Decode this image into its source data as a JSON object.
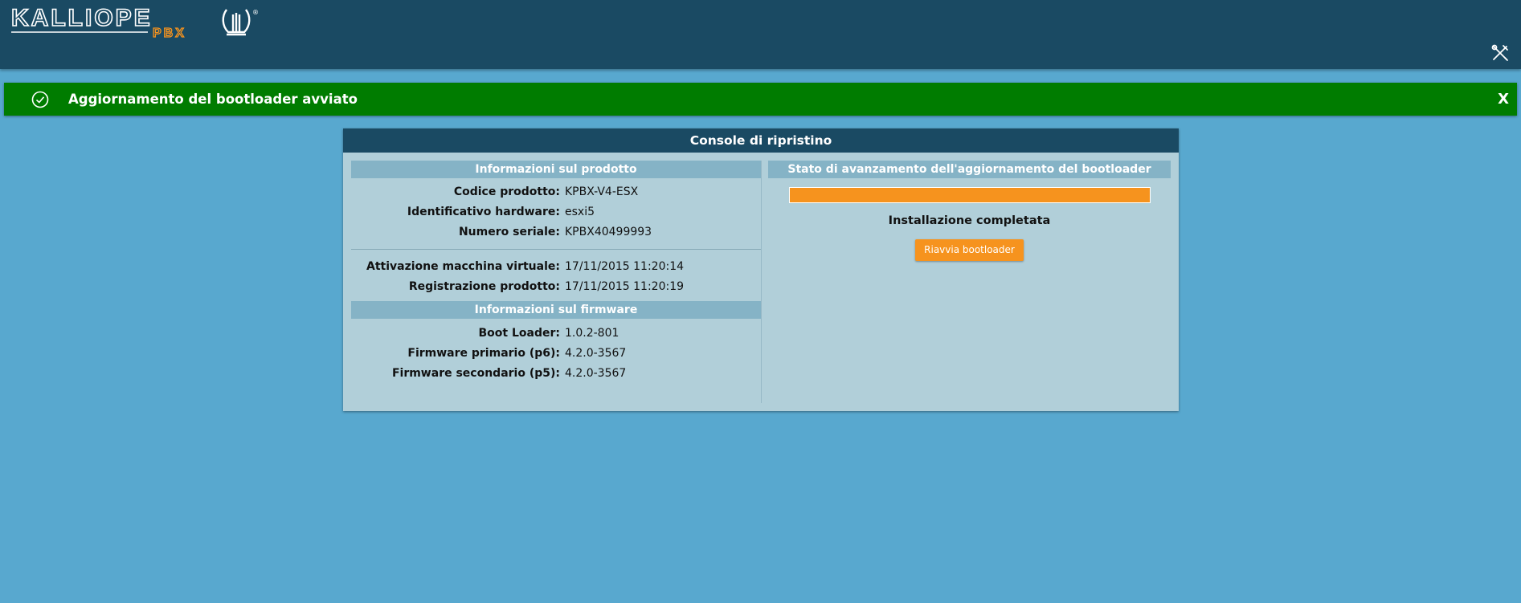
{
  "header": {
    "logo_text": "KALLIOPE",
    "logo_subtext": "PBX",
    "tools_icon": "tools-icon"
  },
  "alert": {
    "icon": "check-circle-icon",
    "message": "Aggiornamento del bootloader avviato",
    "close_label": "X",
    "color": "#007c00"
  },
  "panel": {
    "title": "Console di ripristino",
    "product_section": {
      "title": "Informazioni sul prodotto",
      "rows": [
        {
          "label": "Codice prodotto:",
          "value": "KPBX-V4-ESX"
        },
        {
          "label": "Identificativo hardware:",
          "value": "esxi5"
        },
        {
          "label": "Numero seriale:",
          "value": "KPBX40499993"
        }
      ],
      "rows2": [
        {
          "label": "Attivazione macchina virtuale:",
          "value": "17/11/2015 11:20:14"
        },
        {
          "label": "Registrazione prodotto:",
          "value": "17/11/2015 11:20:19"
        }
      ]
    },
    "firmware_section": {
      "title": "Informazioni sul firmware",
      "rows": [
        {
          "label": "Boot Loader:",
          "value": "1.0.2-801"
        },
        {
          "label": "Firmware primario (p6):",
          "value": "4.2.0-3567"
        },
        {
          "label": "Firmware secondario (p5):",
          "value": "4.2.0-3567"
        }
      ]
    },
    "progress_section": {
      "title": "Stato di avanzamento dell'aggiornamento del bootloader",
      "progress_fraction": 1.0,
      "status_text": "Installazione completata",
      "button_label": "Riavvia bootloader",
      "accent_color": "#f6931e"
    }
  }
}
